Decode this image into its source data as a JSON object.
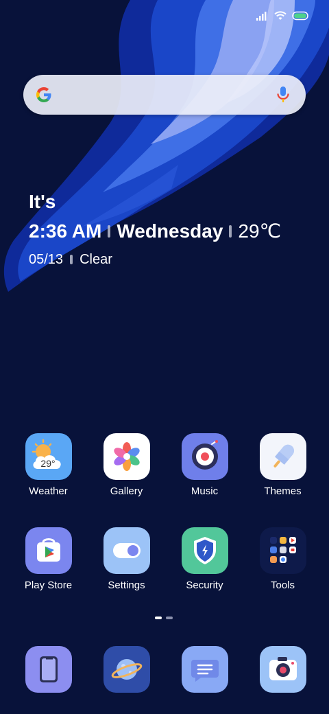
{
  "colors": {
    "background": "#08123a",
    "wave_light": "#7d93f0",
    "wave_mid": "#2a5fe0",
    "wave_dark": "#1435b0"
  },
  "status_bar": {
    "icons": [
      "signal-icon",
      "wifi-icon",
      "battery-icon"
    ]
  },
  "search": {
    "logo": "google-g-icon",
    "mic": "microphone-icon"
  },
  "clock_widget": {
    "greeting": "It's",
    "time": "2:36 AM",
    "day": "Wednesday",
    "temperature": "29℃",
    "date": "05/13",
    "condition": "Clear"
  },
  "apps_row1": [
    {
      "label": "Weather",
      "icon": "weather-icon",
      "badge": "29°"
    },
    {
      "label": "Gallery",
      "icon": "gallery-icon"
    },
    {
      "label": "Music",
      "icon": "music-icon"
    },
    {
      "label": "Themes",
      "icon": "themes-icon"
    }
  ],
  "apps_row2": [
    {
      "label": "Play Store",
      "icon": "play-store-icon"
    },
    {
      "label": "Settings",
      "icon": "settings-icon"
    },
    {
      "label": "Security",
      "icon": "security-icon"
    },
    {
      "label": "Tools",
      "icon": "tools-folder-icon"
    }
  ],
  "page_indicator": {
    "pages": 2,
    "current": 1
  },
  "dock": [
    {
      "icon": "phone-icon"
    },
    {
      "icon": "browser-icon"
    },
    {
      "icon": "messages-icon"
    },
    {
      "icon": "camera-icon"
    }
  ]
}
